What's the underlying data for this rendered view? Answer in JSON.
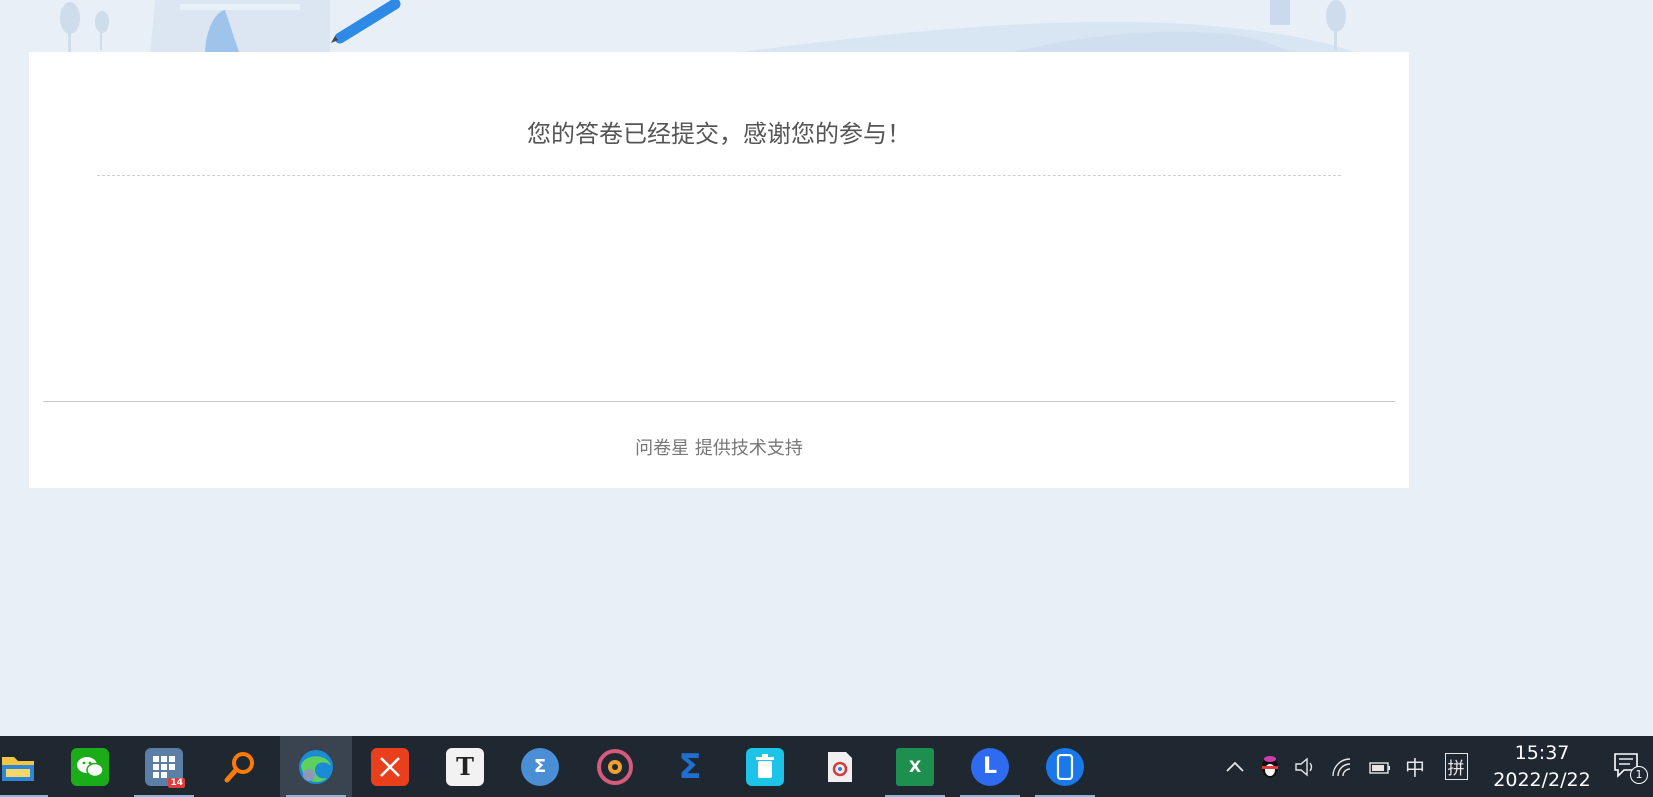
{
  "page": {
    "thanks_message": "您的答卷已经提交，感谢您的参与！",
    "footer_text": "问卷星 提供技术支持"
  },
  "taskbar": {
    "apps": [
      {
        "name": "file-explorer",
        "icon": "folder-icon",
        "color": "#f4c542"
      },
      {
        "name": "wechat",
        "icon": "wechat-icon",
        "color": "#1aad19"
      },
      {
        "name": "calendar-app",
        "icon": "calendar-grid-icon",
        "color": "#5b7fa6",
        "badge": "14"
      },
      {
        "name": "search-tool",
        "icon": "magnifier-icon",
        "color": "#ff7a00"
      },
      {
        "name": "edge-browser",
        "icon": "edge-icon",
        "color": "#2a9bd8",
        "active": true
      },
      {
        "name": "xmind",
        "icon": "x-close-icon",
        "color": "#e8401c"
      },
      {
        "name": "typora",
        "icon": "t-letter-icon",
        "color": "#f2f2f2",
        "letter": "T"
      },
      {
        "name": "math-tool",
        "icon": "sigma-circle-icon",
        "color": "#4a8ed6",
        "letter": "Σ"
      },
      {
        "name": "music-player",
        "icon": "disc-icon",
        "color": "#d65a7a"
      },
      {
        "name": "mathtype",
        "icon": "sigma-icon",
        "color": "#1f6fd1",
        "letter": "Σ"
      },
      {
        "name": "recycle-app",
        "icon": "bin-icon",
        "color": "#1ec3e8"
      },
      {
        "name": "wps-pdf",
        "icon": "pdf-icon",
        "color": "#f0f0f0"
      },
      {
        "name": "excel",
        "icon": "excel-icon",
        "color": "#1d8f4e",
        "letter": "X"
      },
      {
        "name": "lark",
        "icon": "l-letter-icon",
        "color": "#2f6bf0",
        "letter": "L"
      },
      {
        "name": "phone-link",
        "icon": "phone-icon",
        "color": "#1a78e8"
      }
    ],
    "tray": {
      "ime_lang": "中",
      "ime_mode": "拼",
      "time": "15:37",
      "date": "2022/2/22",
      "notification_count": "1"
    }
  }
}
